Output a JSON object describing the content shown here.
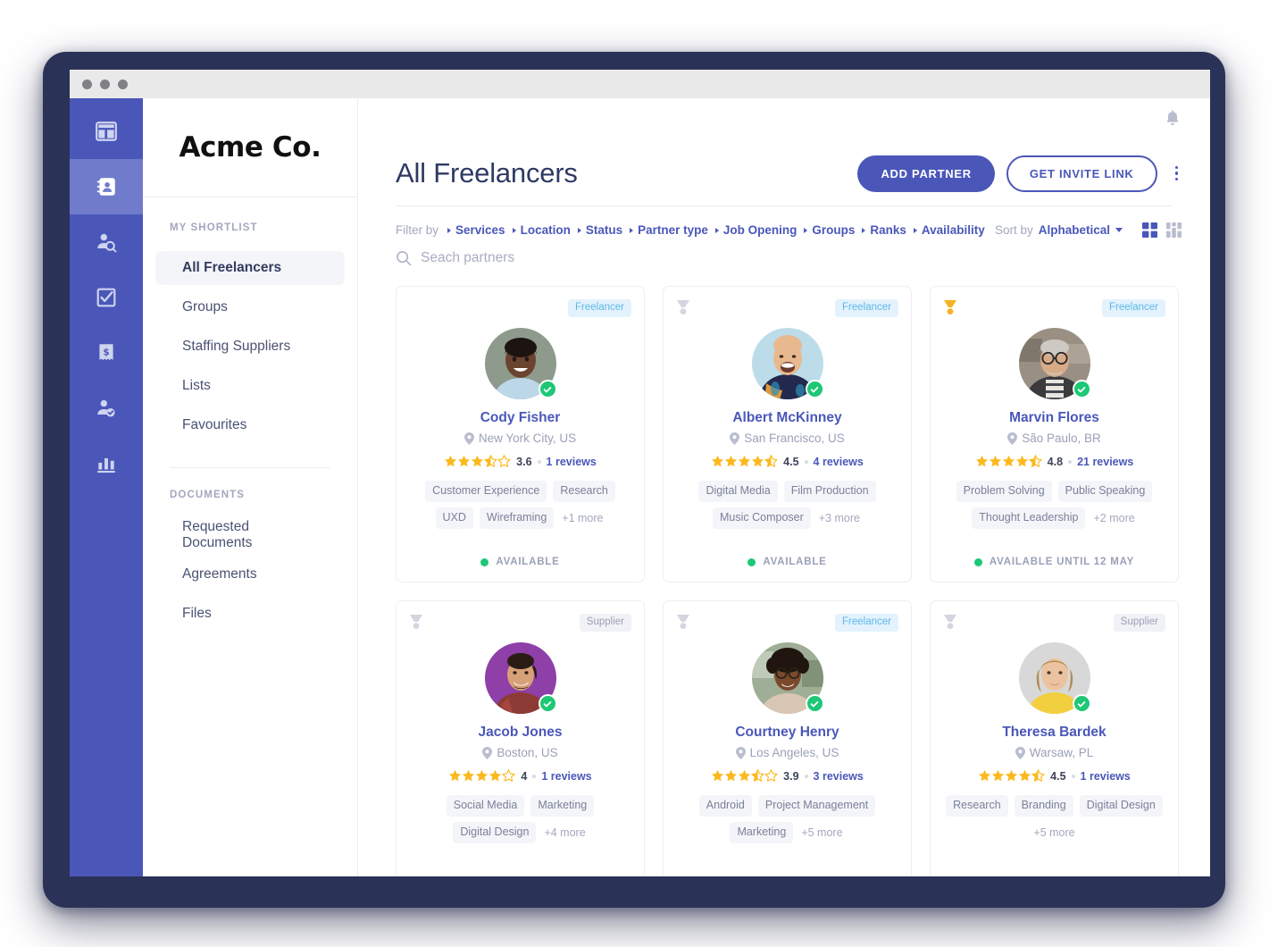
{
  "window": {
    "traffic_dots": 3
  },
  "rail": {
    "items": [
      {
        "icon": "dashboard-icon",
        "active": false
      },
      {
        "icon": "contacts-icon",
        "active": true
      },
      {
        "icon": "user-search-icon",
        "active": false
      },
      {
        "icon": "checkbox-tasks-icon",
        "active": false
      },
      {
        "icon": "invoice-dollar-icon",
        "active": false
      },
      {
        "icon": "user-approved-icon",
        "active": false
      },
      {
        "icon": "analytics-bar-icon",
        "active": false
      }
    ]
  },
  "sidebar": {
    "brand": "Acme Co.",
    "sections": [
      {
        "heading": "MY SHORTLIST",
        "items": [
          {
            "label": "All Freelancers",
            "active": true
          },
          {
            "label": "Groups",
            "active": false
          },
          {
            "label": "Staffing Suppliers",
            "active": false
          },
          {
            "label": "Lists",
            "active": false
          },
          {
            "label": "Favourites",
            "active": false
          }
        ]
      },
      {
        "heading": "DOCUMENTS",
        "items": [
          {
            "label": "Requested Documents",
            "active": false
          },
          {
            "label": "Agreements",
            "active": false
          },
          {
            "label": "Files",
            "active": false
          }
        ]
      }
    ]
  },
  "header": {
    "title": "All Freelancers",
    "add_partner_label": "ADD PARTNER",
    "get_invite_link_label": "GET INVITE LINK",
    "notification_icon": "bell-icon",
    "more_icon": "kebab-menu-icon"
  },
  "filters": {
    "label": "Filter by",
    "chips": [
      "Services",
      "Location",
      "Status",
      "Partner type",
      "Job Opening",
      "Groups",
      "Ranks",
      "Availability"
    ],
    "sort_label": "Sort by",
    "sort_value": "Alphabetical",
    "views": [
      {
        "name": "grid-view-toggle",
        "active": true
      },
      {
        "name": "compact-view-toggle",
        "active": false
      }
    ]
  },
  "search": {
    "placeholder": "Seach partners",
    "value": "",
    "icon": "search-icon"
  },
  "colors": {
    "brand": "#4a57b9",
    "rail": "#4a57b9",
    "rail_active": "#707ccb",
    "star": "#fcb91e",
    "available": "#1ec776",
    "freelancer_badge_bg": "#e3f2fd",
    "freelancer_badge_text": "#5bb8e8",
    "supplier_badge_bg": "#f1f2f6",
    "supplier_badge_text": "#9ba0b8",
    "medal_gold": "#f5b225",
    "medal_grey": "#d3d6e0"
  },
  "cards": [
    {
      "name": "Cody Fisher",
      "location": "New York City, US",
      "badge": "Freelancer",
      "badge_type": "freelancer",
      "medal": "none",
      "score": "3.6",
      "stars_full": 3,
      "stars_half": 1,
      "stars_empty": 1,
      "reviews": "1 reviews",
      "verified": true,
      "avatar_bg": "#8e9a8c",
      "skin": "#6b4430",
      "shirt": "#bcd7e8",
      "hair": "#1c1410",
      "tags": [
        "Customer Experience",
        "Research",
        "UXD",
        "Wireframing"
      ],
      "more": "+1 more",
      "availability": "AVAILABLE"
    },
    {
      "name": "Albert McKinney",
      "location": "San Francisco, US",
      "badge": "Freelancer",
      "badge_type": "freelancer",
      "medal": "grey",
      "score": "4.5",
      "stars_full": 4,
      "stars_half": 1,
      "stars_empty": 0,
      "reviews": "4 reviews",
      "verified": true,
      "avatar_bg": "#bcdcea",
      "skin": "#e8b98f",
      "shirt": "#22294d",
      "hair": "#e8b98f",
      "tags": [
        "Digital Media",
        "Film Production",
        "Music Composer"
      ],
      "more": "+3 more",
      "availability": "AVAILABLE"
    },
    {
      "name": "Marvin Flores",
      "location": "São Paulo, BR",
      "badge": "Freelancer",
      "badge_type": "freelancer",
      "medal": "gold",
      "score": "4.8",
      "stars_full": 4,
      "stars_half": 1,
      "stars_empty": 0,
      "reviews": "21 reviews",
      "verified": true,
      "avatar_bg": "#9a8f83",
      "skin": "#d8ab87",
      "shirt": "#3b3a3c",
      "hair": "#cfc9c4",
      "tags": [
        "Problem Solving",
        "Public Speaking",
        "Thought Leadership"
      ],
      "more": "+2 more",
      "availability": "AVAILABLE UNTIL 12 MAY"
    },
    {
      "name": "Jacob Jones",
      "location": "Boston, US",
      "badge": "Supplier",
      "badge_type": "supplier",
      "medal": "grey",
      "score": "4",
      "stars_full": 4,
      "stars_half": 0,
      "stars_empty": 1,
      "reviews": "1 reviews",
      "verified": true,
      "avatar_bg": "#8e3fa8",
      "skin": "#d6a078",
      "shirt": "#8c3a34",
      "hair": "#2a1c14",
      "tags": [
        "Social Media",
        "Marketing",
        "Digital Design"
      ],
      "more": "+4 more",
      "availability": ""
    },
    {
      "name": "Courtney Henry",
      "location": "Los Angeles, US",
      "badge": "Freelancer",
      "badge_type": "freelancer",
      "medal": "grey",
      "score": "3.9",
      "stars_full": 3,
      "stars_half": 1,
      "stars_empty": 1,
      "reviews": "3 reviews",
      "verified": true,
      "avatar_bg": "#9fae96",
      "skin": "#7a4a2c",
      "shirt": "#d9c6b4",
      "hair": "#20160f",
      "tags": [
        "Android",
        "Project Management",
        "Marketing"
      ],
      "more": "+5 more",
      "availability": ""
    },
    {
      "name": "Theresa Bardek",
      "location": "Warsaw, PL",
      "badge": "Supplier",
      "badge_type": "supplier",
      "medal": "grey",
      "score": "4.5",
      "stars_full": 4,
      "stars_half": 1,
      "stars_empty": 0,
      "reviews": "1 reviews",
      "verified": true,
      "avatar_bg": "#d8d8d8",
      "skin": "#ecc3a0",
      "shirt": "#f2cf3e",
      "hair": "#b08a50",
      "tags": [
        "Research",
        "Branding",
        "Digital Design"
      ],
      "more": "+5 more",
      "availability": ""
    }
  ]
}
